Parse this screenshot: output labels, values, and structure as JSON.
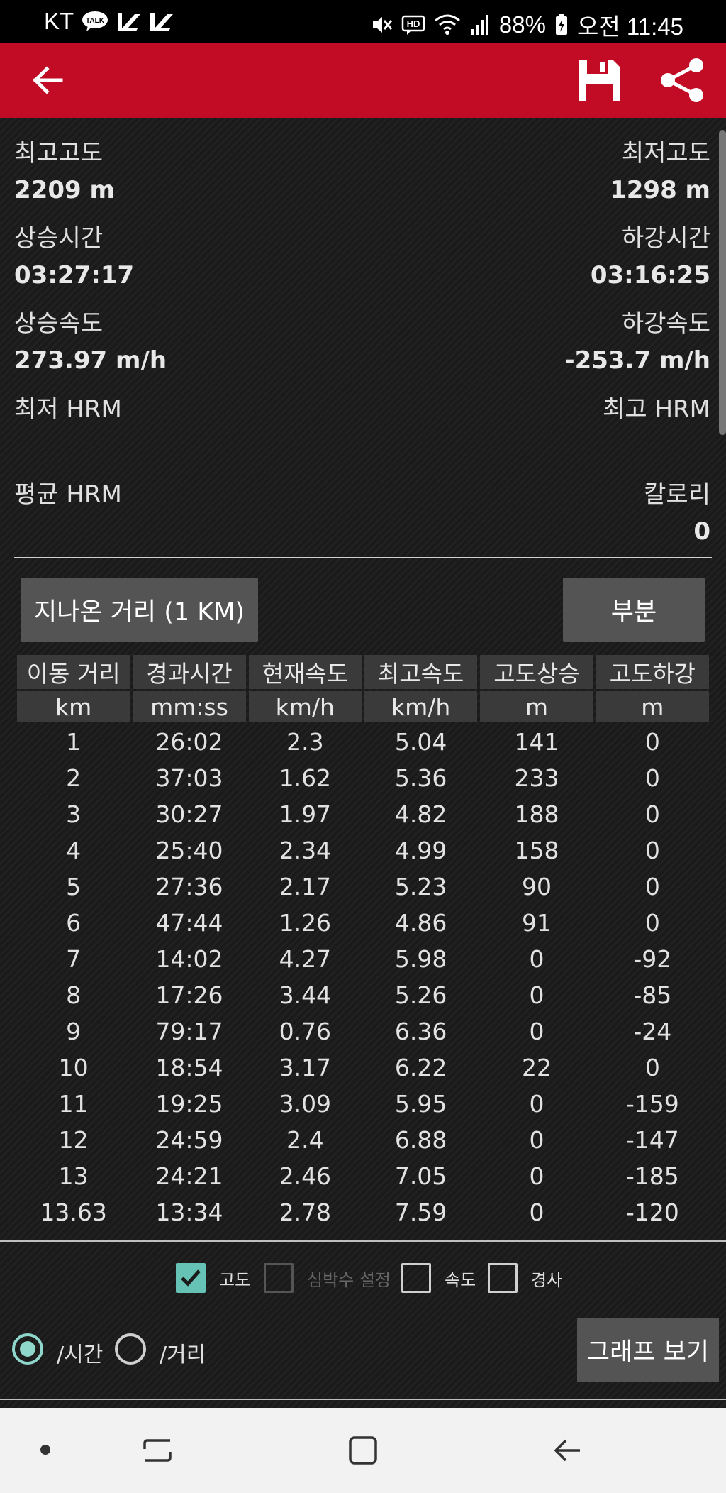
{
  "status_bar": {
    "carrier": "KT",
    "talk_badge": "TALK",
    "battery": "88%",
    "time": "오전 11:45",
    "hd_badge": "HD"
  },
  "app_bar": {
    "back_icon": "arrow-left-icon",
    "save_icon": "floppy-disk-icon",
    "share_icon": "share-icon",
    "accent_color": "#c20c25"
  },
  "stats": {
    "max_altitude": {
      "label": "최고고도",
      "value": "2209 m"
    },
    "min_altitude": {
      "label": "최저고도",
      "value": "1298 m"
    },
    "ascent_time": {
      "label": "상승시간",
      "value": "03:27:17"
    },
    "descent_time": {
      "label": "하강시간",
      "value": "03:16:25"
    },
    "ascent_speed": {
      "label": "상승속도",
      "value": "273.97 m/h"
    },
    "descent_speed": {
      "label": "하강속도",
      "value": "-253.7 m/h"
    },
    "min_hrm": {
      "label": "최저 HRM",
      "value": ""
    },
    "max_hrm": {
      "label": "최고 HRM",
      "value": ""
    },
    "avg_hrm": {
      "label": "평균 HRM",
      "value": ""
    },
    "calories": {
      "label": "칼로리",
      "value": "0"
    }
  },
  "buttons": {
    "distance": "지나온 거리 (1  KM)",
    "partial": "부분",
    "view_graph": "그래프 보기"
  },
  "table": {
    "headers": [
      "이동 거리",
      "경과시간",
      "현재속도",
      "최고속도",
      "고도상승",
      "고도하강"
    ],
    "units": [
      "km",
      "mm:ss",
      "km/h",
      "km/h",
      "m",
      "m"
    ],
    "rows": [
      [
        "1",
        "26:02",
        "2.3",
        "5.04",
        "141",
        "0"
      ],
      [
        "2",
        "37:03",
        "1.62",
        "5.36",
        "233",
        "0"
      ],
      [
        "3",
        "30:27",
        "1.97",
        "4.82",
        "188",
        "0"
      ],
      [
        "4",
        "25:40",
        "2.34",
        "4.99",
        "158",
        "0"
      ],
      [
        "5",
        "27:36",
        "2.17",
        "5.23",
        "90",
        "0"
      ],
      [
        "6",
        "47:44",
        "1.26",
        "4.86",
        "91",
        "0"
      ],
      [
        "7",
        "14:02",
        "4.27",
        "5.98",
        "0",
        "-92"
      ],
      [
        "8",
        "17:26",
        "3.44",
        "5.26",
        "0",
        "-85"
      ],
      [
        "9",
        "79:17",
        "0.76",
        "6.36",
        "0",
        "-24"
      ],
      [
        "10",
        "18:54",
        "3.17",
        "6.22",
        "22",
        "0"
      ],
      [
        "11",
        "19:25",
        "3.09",
        "5.95",
        "0",
        "-159"
      ],
      [
        "12",
        "24:59",
        "2.4",
        "6.88",
        "0",
        "-147"
      ],
      [
        "13",
        "24:21",
        "2.46",
        "7.05",
        "0",
        "-185"
      ],
      [
        "13.63",
        "13:34",
        "2.78",
        "7.59",
        "0",
        "-120"
      ]
    ]
  },
  "graph_options": {
    "altitude": {
      "label": "고도",
      "checked": true
    },
    "heart_rate": {
      "label": "심박수 설정",
      "checked": false,
      "disabled": true
    },
    "speed": {
      "label": "속도",
      "checked": false
    },
    "slope": {
      "label": "경사",
      "checked": false
    }
  },
  "axis_options": {
    "by_time": {
      "label": "/시간",
      "selected": true
    },
    "by_distance": {
      "label": "/거리",
      "selected": false
    }
  },
  "nav_bar": {
    "recent_icon": "recent-apps-icon",
    "home_icon": "home-icon",
    "back_icon": "nav-back-icon"
  }
}
